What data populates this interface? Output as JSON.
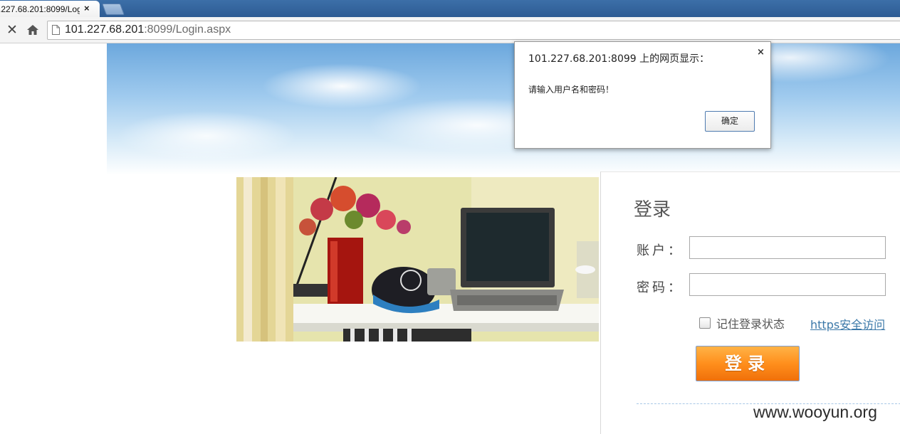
{
  "browser": {
    "tab_title": ".227.68.201:8099/Login.aspx",
    "tab_close": "×",
    "url_host": "101.227.68.201",
    "url_rest": ":8099/Login.aspx"
  },
  "icons": {
    "stop": "stop-icon",
    "home": "home-icon",
    "page": "page-icon",
    "close": "close-icon"
  },
  "dialog": {
    "title": "101.227.68.201:8099 上的网页显示：",
    "close_label": "×",
    "message": "请输入用户名和密码！",
    "ok_label": "确定"
  },
  "login": {
    "title": "登录",
    "account_label": "账户：",
    "account_value": "",
    "password_label": "密码：",
    "password_value": "",
    "remember_label": "记住登录状态",
    "remember_checked": false,
    "https_link": "https安全访问",
    "button_label": "登录"
  },
  "watermark": "www.wooyun.org",
  "colors": {
    "tab_bar": "#2d5b93",
    "button_orange": "#ff8f1c",
    "link_blue": "#3b78a8",
    "sky_blue": "#6ca8dd"
  }
}
